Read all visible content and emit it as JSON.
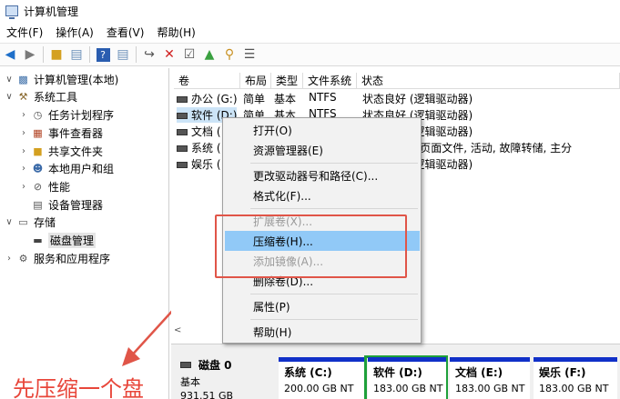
{
  "window": {
    "title": "计算机管理"
  },
  "menubar": {
    "items": [
      "文件(F)",
      "操作(A)",
      "查看(V)",
      "帮助(H)"
    ]
  },
  "tree": {
    "items": [
      {
        "label": "计算机管理(本地)",
        "icon": "computer-icon",
        "arrow": "∨"
      },
      {
        "label": "系统工具",
        "icon": "tools-icon",
        "arrow": "∨"
      },
      {
        "label": "任务计划程序",
        "icon": "clock-icon",
        "arrow": "›"
      },
      {
        "label": "事件查看器",
        "icon": "event-icon",
        "arrow": "›"
      },
      {
        "label": "共享文件夹",
        "icon": "folder-icon",
        "arrow": "›"
      },
      {
        "label": "本地用户和组",
        "icon": "users-icon",
        "arrow": "›"
      },
      {
        "label": "性能",
        "icon": "performance-icon",
        "arrow": "›"
      },
      {
        "label": "设备管理器",
        "icon": "device-icon",
        "arrow": ""
      },
      {
        "label": "存储",
        "icon": "storage-icon",
        "arrow": "∨"
      },
      {
        "label": "磁盘管理",
        "icon": "disk-icon",
        "arrow": ""
      },
      {
        "label": "服务和应用程序",
        "icon": "services-icon",
        "arrow": "›"
      }
    ]
  },
  "annotation": {
    "text": "先压缩一个盘"
  },
  "table": {
    "headers": [
      "卷",
      "布局",
      "类型",
      "文件系统",
      "状态"
    ],
    "rows": [
      {
        "volume": "办公 (G:)",
        "layout": "简单",
        "type": "基本",
        "fs": "NTFS",
        "status": "状态良好 (逻辑驱动器)"
      },
      {
        "volume": "软件 (D:)",
        "layout": "简单",
        "type": "基本",
        "fs": "NTFS",
        "status": "状态良好 (逻辑驱动器)"
      },
      {
        "volume": "文档 (",
        "layout": "",
        "type": "",
        "fs": "",
        "status": "状态良好 (逻辑驱动器)"
      },
      {
        "volume": "系统 (",
        "layout": "",
        "type": "",
        "fs": "",
        "status": "系统, 启动, 页面文件, 活动, 故障转储, 主分"
      },
      {
        "volume": "娱乐 (",
        "layout": "",
        "type": "",
        "fs": "",
        "status": "状态良好 (逻辑驱动器)"
      }
    ]
  },
  "context_menu": {
    "items": [
      {
        "label": "打开(O)",
        "enabled": true
      },
      {
        "label": "资源管理器(E)",
        "enabled": true
      },
      {
        "label": "更改驱动器号和路径(C)...",
        "enabled": true
      },
      {
        "label": "格式化(F)...",
        "enabled": true
      },
      {
        "label": "扩展卷(X)...",
        "enabled": false
      },
      {
        "label": "压缩卷(H)...",
        "enabled": true,
        "highlighted": true
      },
      {
        "label": "添加镜像(A)...",
        "enabled": false
      },
      {
        "label": "删除卷(D)...",
        "enabled": true
      },
      {
        "label": "属性(P)",
        "enabled": true
      },
      {
        "label": "帮助(H)",
        "enabled": true
      }
    ]
  },
  "disk": {
    "name": "磁盘 0",
    "type": "基本",
    "size": "931.51 GB",
    "partitions": [
      {
        "name": "系统 (C:)",
        "size": "200.00 GB NT"
      },
      {
        "name": "软件 (D:)",
        "size": "183.00 GB NT"
      },
      {
        "name": "文档 (E:)",
        "size": "183.00 GB NT"
      },
      {
        "name": "娱乐 (F:)",
        "size": "183.00 GB NT"
      }
    ]
  },
  "colors": {
    "highlight": "#91c9f7",
    "annotation_red": "#e05548",
    "partition_blue": "#1030c8",
    "selected_green": "#1ea03a"
  }
}
